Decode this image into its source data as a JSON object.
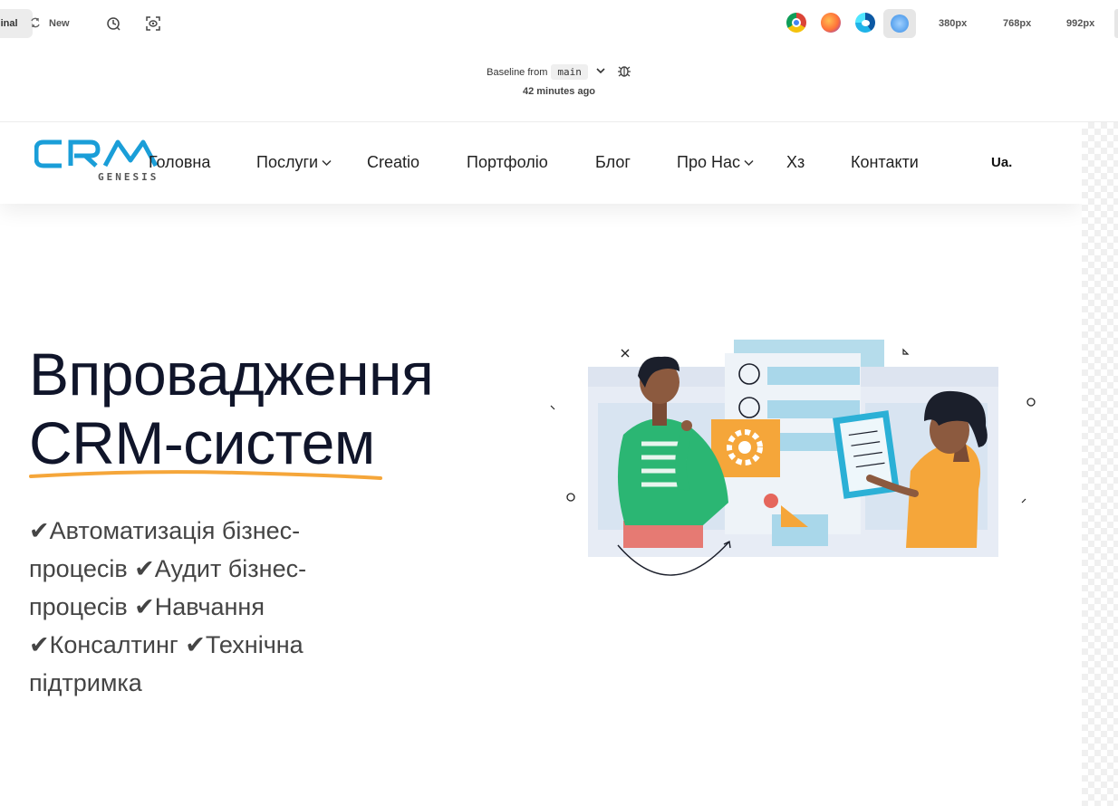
{
  "toolbar": {
    "original_label": "Original",
    "new_label": "New",
    "breakpoints": [
      "380px",
      "768px",
      "992px"
    ]
  },
  "baseline": {
    "prefix": "Baseline from",
    "branch": "main",
    "time": "42 minutes ago"
  },
  "site": {
    "logo_text": "GENESIS",
    "nav": [
      {
        "label": "Головна",
        "dropdown": false
      },
      {
        "label": "Послуги",
        "dropdown": true
      },
      {
        "label": "Creatio",
        "dropdown": false
      },
      {
        "label": "Портфоліо",
        "dropdown": false
      },
      {
        "label": "Блог",
        "dropdown": false
      },
      {
        "label": "Про Нас",
        "dropdown": true
      },
      {
        "label": "Хз",
        "dropdown": false
      },
      {
        "label": "Контакти",
        "dropdown": false
      }
    ],
    "lang": "Ua.",
    "hero": {
      "title_line1": "Впровадження",
      "title_line2": "CRM-систем",
      "services": "✔Автоматизація бізнес-процесів ✔Аудит бізнес-процесів ✔Навчання ✔Консалтинг ✔Технічна підтримка"
    }
  },
  "colors": {
    "logo_blue": "#1a9ed8",
    "accent_orange": "#f5a63a",
    "illus_green": "#2bb673",
    "illus_blue": "#a9d7ea",
    "title": "#10152a"
  }
}
